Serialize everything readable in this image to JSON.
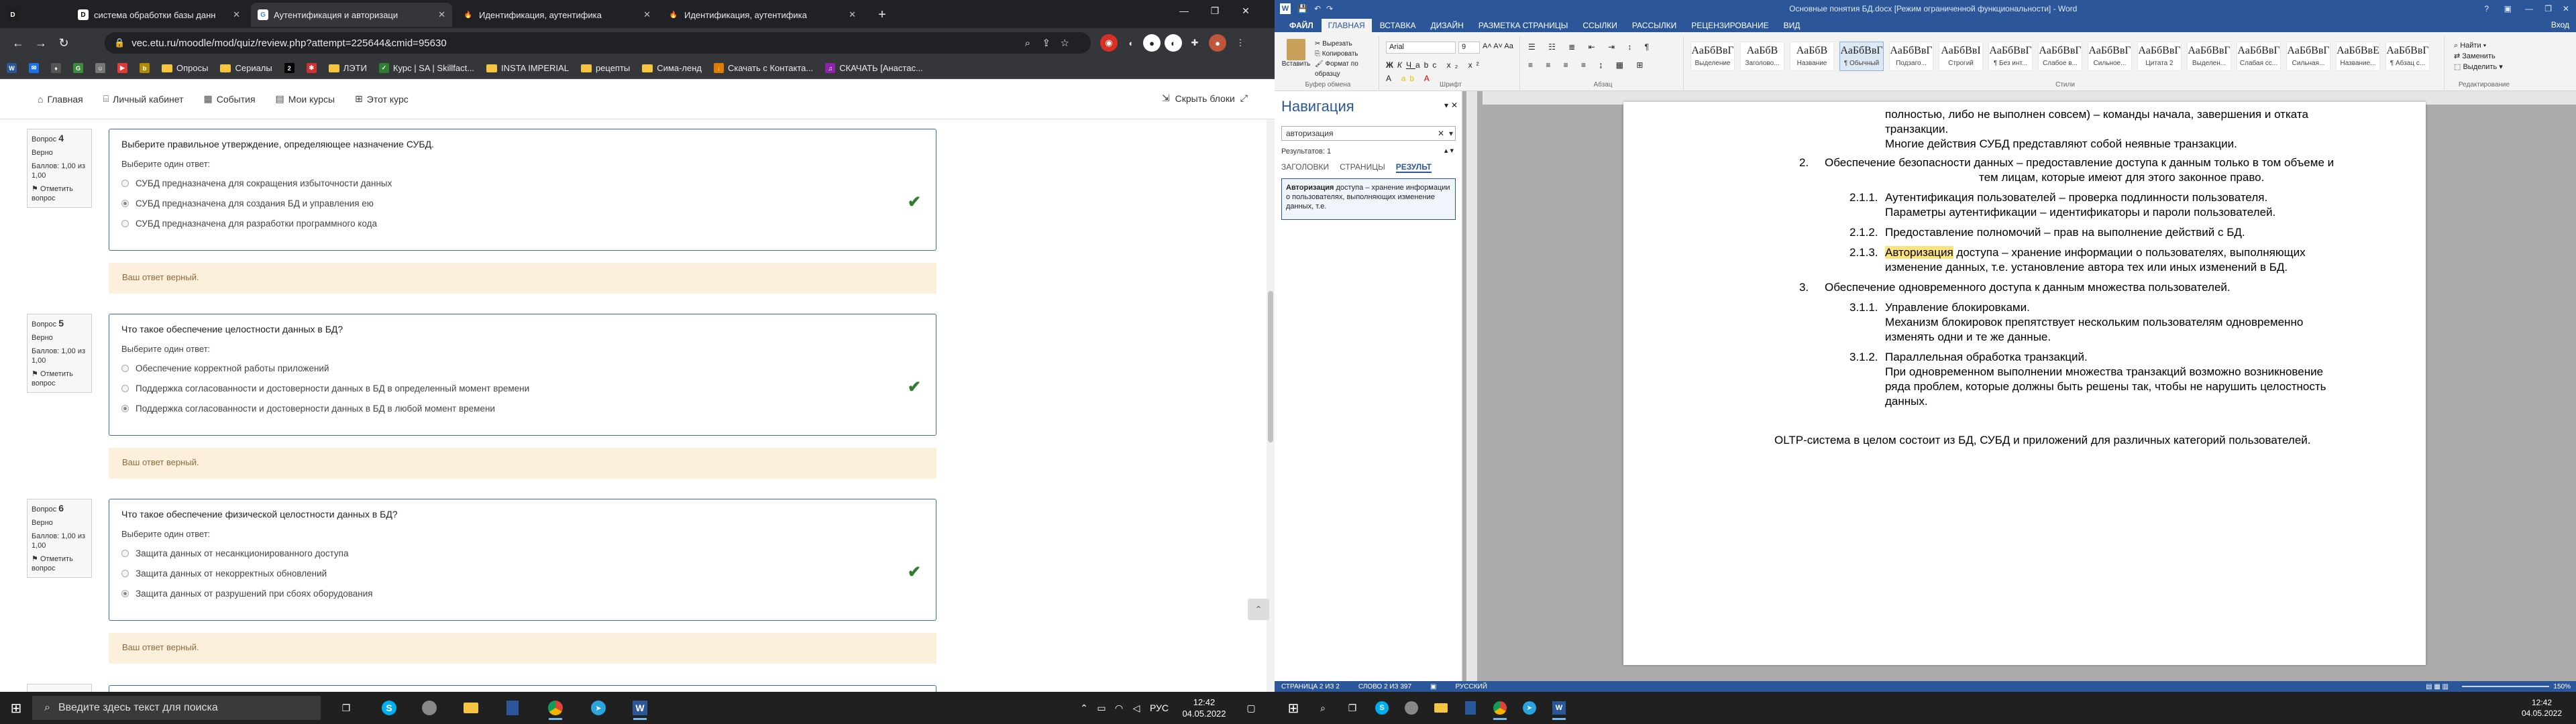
{
  "chrome": {
    "tabs": [
      {
        "title": "система обработки базы данн",
        "icon": "D",
        "color": "#1d1d1d"
      },
      {
        "title": "Аутентификация и авторизаци",
        "icon": "G",
        "color": "#4285f4"
      },
      {
        "title": "Идентификация, аутентифика",
        "icon": "🔥",
        "color": "#e36a1b"
      },
      {
        "title": "Идентификация, аутентифика",
        "icon": "🔥",
        "color": "#e36a1b"
      }
    ],
    "new_tab": "+",
    "url": "vec.etu.ru/moodle/mod/quiz/review.php?attempt=225644&cmid=95630",
    "bookmarks": [
      {
        "label": "",
        "icon": "W",
        "color": "#2b579a"
      },
      {
        "label": "",
        "icon": "✉",
        "color": "#1a73e8"
      },
      {
        "label": "",
        "icon": "♦",
        "color": "#555"
      },
      {
        "label": "",
        "icon": "G",
        "color": "#3c8b3c"
      },
      {
        "label": "",
        "icon": "☺",
        "color": "#777"
      },
      {
        "label": "",
        "icon": "▶",
        "color": "#e53935"
      },
      {
        "label": "",
        "icon": "b",
        "color": "#b38b00"
      },
      {
        "label": "Опросы",
        "folder": true
      },
      {
        "label": "Сериалы",
        "folder": true
      },
      {
        "label": "",
        "icon": "2",
        "color": "#000"
      },
      {
        "label": "",
        "icon": "✱",
        "color": "#d32f2f"
      },
      {
        "label": "ЛЭТИ",
        "folder": true
      },
      {
        "label": "Курс | SA | Skillfact...",
        "icon": "✓",
        "color": "#2e7d32"
      },
      {
        "label": "INSTA IMPERIAL",
        "folder": true
      },
      {
        "label": "рецепты",
        "folder": true
      },
      {
        "label": "Сима-ленд",
        "folder": true
      },
      {
        "label": "Скачать с Контакта...",
        "icon": "↓",
        "color": "#e07b00"
      },
      {
        "label": "СКАЧАТЬ [Анастас...",
        "icon": "♫",
        "color": "#8e24aa"
      }
    ]
  },
  "moodle": {
    "nav": [
      "Главная",
      "Личный кабинет",
      "События",
      "Мои курсы",
      "Этот курс"
    ],
    "hide_blocks": "Скрыть блоки",
    "questions": [
      {
        "label": "Вопрос",
        "num": "4",
        "state": "Верно",
        "score": "Баллов: 1,00 из 1,00",
        "flag": "Отметить вопрос",
        "text": "Выберите правильное утверждение, определяющее назначение СУБД.",
        "prompt": "Выберите один ответ:",
        "options": [
          "СУБД предназначена для сокращения избыточности данных",
          "СУБД предназначена для создания БД и управления ею",
          "СУБД предназначена для разработки программного кода"
        ],
        "selected": 1,
        "feedback": "Ваш ответ верный."
      },
      {
        "label": "Вопрос",
        "num": "5",
        "state": "Верно",
        "score": "Баллов: 1,00 из 1,00",
        "flag": "Отметить вопрос",
        "text": "Что такое обеспечение целостности данных в БД?",
        "prompt": "Выберите один ответ:",
        "options": [
          "Обеспечение корректной работы приложений",
          "Поддержка согласованности и достоверности данных в БД в определенный момент времени",
          "Поддержка согласованности и достоверности данных в БД в любой момент времени"
        ],
        "selected": 2,
        "feedback": "Ваш ответ верный."
      },
      {
        "label": "Вопрос",
        "num": "6",
        "state": "Верно",
        "score": "Баллов: 1,00 из 1,00",
        "flag": "Отметить вопрос",
        "text": "Что такое обеспечение физической целостности данных в БД?",
        "prompt": "Выберите один ответ:",
        "options": [
          "Защита данных от несанкционированного доступа",
          "Защита данных от некорректных обновлений",
          "Защита данных от разрушений при сбоях оборудования"
        ],
        "selected": 2,
        "feedback": "Ваш ответ верный."
      }
    ]
  },
  "word": {
    "title": "Основные понятия БД.docx [Режим ограниченной функциональности] - Word",
    "tabs": [
      "ФАЙЛ",
      "ГЛАВНАЯ",
      "ВСТАВКА",
      "ДИЗАЙН",
      "РАЗМЕТКА СТРАНИЦЫ",
      "ССЫЛКИ",
      "РАССЫЛКИ",
      "РЕЦЕНЗИРОВАНИЕ",
      "ВИД"
    ],
    "user": "Вход",
    "clipboard": {
      "paste": "Вставить",
      "cut": "Вырезать",
      "copy": "Копировать",
      "format": "Формат по образцу",
      "label": "Буфер обмена"
    },
    "font": {
      "name": "Arial",
      "size": "9",
      "label": "Шрифт"
    },
    "paragraph_label": "Абзац",
    "styles_label": "Стили",
    "styles": [
      {
        "preview": "АаБбВвГ",
        "name": "Выделение"
      },
      {
        "preview": "АаБбВ",
        "name": "Заголово..."
      },
      {
        "preview": "АаБбВ",
        "name": "Название"
      },
      {
        "preview": "АаБбВвГ",
        "name": "¶ Обычный"
      },
      {
        "preview": "АаБбВвГ",
        "name": "Подзаго..."
      },
      {
        "preview": "АаБбВвІ",
        "name": "Строгий"
      },
      {
        "preview": "АаБбВвГ",
        "name": "¶ Без инт..."
      },
      {
        "preview": "АаБбВвГ",
        "name": "Слабое в..."
      },
      {
        "preview": "АаБбВвГ",
        "name": "Сильное..."
      },
      {
        "preview": "АаБбВвГ",
        "name": "Цитата 2"
      },
      {
        "preview": "АаБбВвГ",
        "name": "Выделен..."
      },
      {
        "preview": "АаБбВвГ",
        "name": "Слабая сс..."
      },
      {
        "preview": "АаБбВвГ",
        "name": "Сильная..."
      },
      {
        "preview": "АаБбВвЕ",
        "name": "Название..."
      },
      {
        "preview": "АаБбВвГ",
        "name": "¶ Абзац с..."
      }
    ],
    "editing": {
      "find": "Найти",
      "replace": "Заменить",
      "select": "Выделить",
      "label": "Редактирование"
    },
    "nav": {
      "title": "Навигация",
      "query": "авторизация",
      "results": "Результатов: 1",
      "subtabs": [
        "ЗАГОЛОВКИ",
        "СТРАНИЦЫ",
        "РЕЗУЛЬТ"
      ],
      "result_bold": "Авторизация",
      "result_rest": " доступа – хранение информации о пользователях, выполняющих изменение данных, т.е."
    },
    "doc": {
      "l1": "полностью, либо не выполнен совсем) – команды начала, завершения и отката",
      "l2": "транзакции.",
      "l3": "Многие действия СУБД представляют собой неявные транзакции.",
      "p2num": "2.",
      "p2a": "Обеспечение безопасности данных – предоставление доступа к данным только в том объеме и",
      "p2b": "тем лицам, которые имеют для этого законное право.",
      "p211n": "2.1.1.",
      "p211a": "Аутентификация пользователей – проверка подлинности пользователя.",
      "p211b": "Параметры аутентификации – идентификаторы и пароли пользователей.",
      "p212n": "2.1.2.",
      "p212a": "Предоставление полномочий – прав на выполнение действий с БД.",
      "p213n": "2.1.3.",
      "p213hl": "Авторизация",
      "p213a": " доступа – хранение информации о пользователях, выполняющих",
      "p213b": "изменение данных, т.е. установление автора тех или иных изменений в БД.",
      "p3num": "3.",
      "p3a": "Обеспечение одновременного доступа к данным множества пользователей.",
      "p311n": "3.1.1.",
      "p311a": "Управление блокировками.",
      "p311b": "Механизм блокировок препятствует нескольким пользователям одновременно",
      "p311c": "изменять одни и те же данные.",
      "p312n": "3.1.2.",
      "p312a": "Параллельная обработка транзакций.",
      "p312b": "При одновременном выполнении множества транзакций возможно возникновение",
      "p312c": "ряда проблем, которые должны быть решены так, чтобы не нарушить целостность",
      "p312d": "данных.",
      "oltp": "OLTP-система в целом состоит из БД, СУБД и приложений для различных категорий пользователей."
    },
    "status": {
      "page": "СТРАНИЦА 2 ИЗ 2",
      "words": "СЛОВО 2 ИЗ 397",
      "lang": "РУССКИЙ",
      "zoom": "150%"
    }
  },
  "taskbar": {
    "search_placeholder": "Введите здесь текст для поиска",
    "lang": "РУС",
    "time_left": "12:42",
    "date_left": "04.05.2022",
    "time_right": "12:42",
    "date_right": "04.05.2022"
  }
}
